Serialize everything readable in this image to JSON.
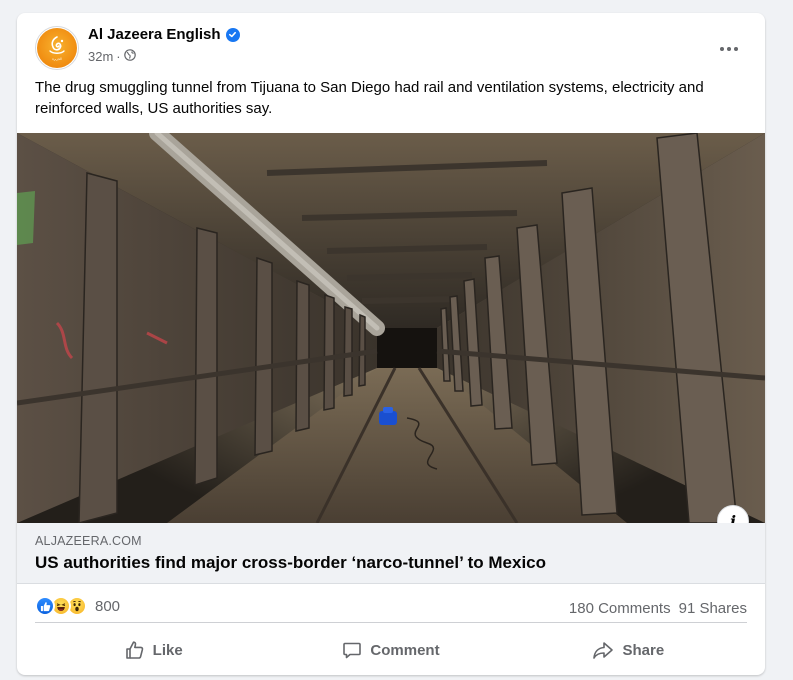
{
  "post": {
    "page_name": "Al Jazeera English",
    "time": "32m",
    "separator": "·",
    "text": "The drug smuggling tunnel from Tijuana to San Diego had rail and ventilation systems, electricity and reinforced walls, US authorities say.",
    "avatar_text": "الجزيرة",
    "icons": {
      "verified": "verified-badge-icon",
      "audience": "globe-icon",
      "more": "more-options-icon"
    }
  },
  "link_preview": {
    "domain": "ALJAZEERA.COM",
    "title": "US authorities find major cross-border ‘narco-tunnel’ to Mexico",
    "info_label": "i",
    "image_description_icon": "tunnel-photo"
  },
  "engagement": {
    "reactions": [
      "like",
      "haha",
      "wow"
    ],
    "reaction_count": "800",
    "comments": "180 Comments",
    "shares": "91 Shares"
  },
  "actions": {
    "like": "Like",
    "comment": "Comment",
    "share": "Share"
  },
  "colors": {
    "brand_blue": "#1877f2",
    "secondary_text": "#65676b",
    "background": "#f0f2f5",
    "aljazeera_orange": "#f08c11"
  }
}
